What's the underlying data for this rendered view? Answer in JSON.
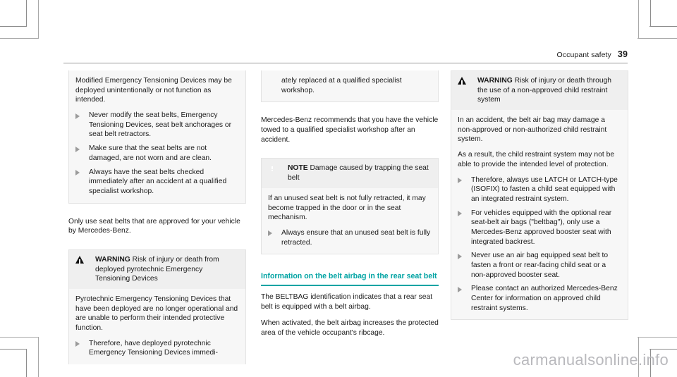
{
  "header": {
    "section_title": "Occupant safety",
    "page_number": "39"
  },
  "watermark": "carmanualsonline.info",
  "icons": {
    "warning": "warning-triangle-icon",
    "note": "note-square-icon",
    "bullet": "bullet-triangle-icon"
  },
  "colors": {
    "accent_teal": "#00a3a3",
    "callout_head_bg": "#efefef",
    "callout_body_bg": "#f7f7f7",
    "bullet_gray": "#9b9b9b"
  },
  "column1": {
    "warning_continued": {
      "body_p1": "Modified Emergency Tensioning Devices may be deployed unintentionally or not function as intended.",
      "bullets": [
        "Never modify the seat belts, Emergency Tensioning Devices, seat belt anchorages or seat belt retractors.",
        "Make sure that the seat belts are not damaged, are not worn and are clean.",
        "Always have the seat belts checked immediately after an accident at a qualified specialist workshop."
      ]
    },
    "paragraph_1": "Only use seat belts that are approved for your vehicle by Mercedes-Benz.",
    "warning_2": {
      "keyword": "WARNING",
      "title": "Risk of injury or death from deployed pyrotechnic Emergency Tensioning Devices",
      "body_p1": "Pyrotechnic Emergency Tensioning Devices that have been deployed are no longer operational and are unable to perform their intended protective function.",
      "bullets": [
        "Therefore, have deployed pyrotechnic Emergency Tensioning Devices immedi-"
      ]
    }
  },
  "column2": {
    "warning_2_continued": {
      "bullet_continuation": "ately replaced at a qualified specialist workshop."
    },
    "paragraph_1": "Mercedes-Benz recommends that you have the vehicle towed to a qualified specialist workshop after an accident.",
    "note_1": {
      "keyword": "NOTE",
      "title": "Damage caused by trapping the seat belt",
      "body_p1": "If an unused seat belt is not fully retracted, it may become trapped in the door or in the seat mechanism.",
      "bullets": [
        "Always ensure that an unused seat belt is fully retracted."
      ]
    },
    "section": {
      "heading": "Information on the belt airbag in the rear seat belt",
      "paragraph_1": "The BELTBAG identification indicates that a rear seat belt is equipped with a belt airbag.",
      "paragraph_2": "When activated, the belt airbag increases the protected area of the vehicle occupant's ribcage."
    }
  },
  "column3": {
    "warning_3": {
      "keyword": "WARNING",
      "title": "Risk of injury or death through the use of a non-approved child restraint system",
      "body_p1": "In an accident, the belt air bag may damage a non-approved or non-authorized child restraint system.",
      "body_p2": "As a result, the child restraint system may not be able to provide the intended level of protection.",
      "bullets": [
        "Therefore, always use LATCH or LATCH-type (ISOFIX) to fasten a child seat equipped with an integrated restraint system.",
        "For vehicles equipped with the optional rear seat-belt air bags (\"beltbag\"), only use a Mercedes-Benz approved booster seat with integrated backrest.",
        "Never use an air bag equipped seat belt to fasten a front or rear-facing child seat or a non-approved booster seat.",
        "Please contact an authorized Mercedes-Benz Center for information on approved child restraint systems."
      ]
    }
  }
}
